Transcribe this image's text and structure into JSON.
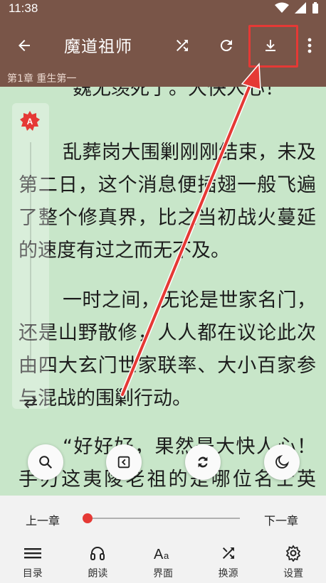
{
  "status_bar": {
    "time": "11:38"
  },
  "app_bar": {
    "title": "魔道祖师"
  },
  "chapter_title": "第1章 重生第一",
  "content": {
    "paragraphs": [
      "“魏无羡死了。大快人心！”",
      "乱葬岗大围剿刚刚结束，未及第二日，这个消息便插翅一般飞遍了整个修真界，比之当初战火蔓延的速度有过之而无不及。",
      "一时之间，无论是世家名门，还是山野散修，人人都在议论此次由四大玄门世家联率、大小百家参与混战的围剿行动。",
      "“好好好，果然是大快人心！手刃这夷陵老祖的是哪位名士英豪？”"
    ]
  },
  "bottom_bar": {
    "prev_chapter": "上一章",
    "next_chapter": "下一章",
    "progress": 0.0,
    "tabs": [
      {
        "label": "目录",
        "icon": "menu-list-icon"
      },
      {
        "label": "朗读",
        "icon": "headphones-icon"
      },
      {
        "label": "界面",
        "icon": "font-size-icon"
      },
      {
        "label": "换源",
        "icon": "shuffle-icon"
      },
      {
        "label": "设置",
        "icon": "gear-icon"
      }
    ]
  },
  "colors": {
    "toolbar": "#795548",
    "reading_bg": "#C8E6C9",
    "accent": "#E53935",
    "annotation": "#E53935"
  }
}
